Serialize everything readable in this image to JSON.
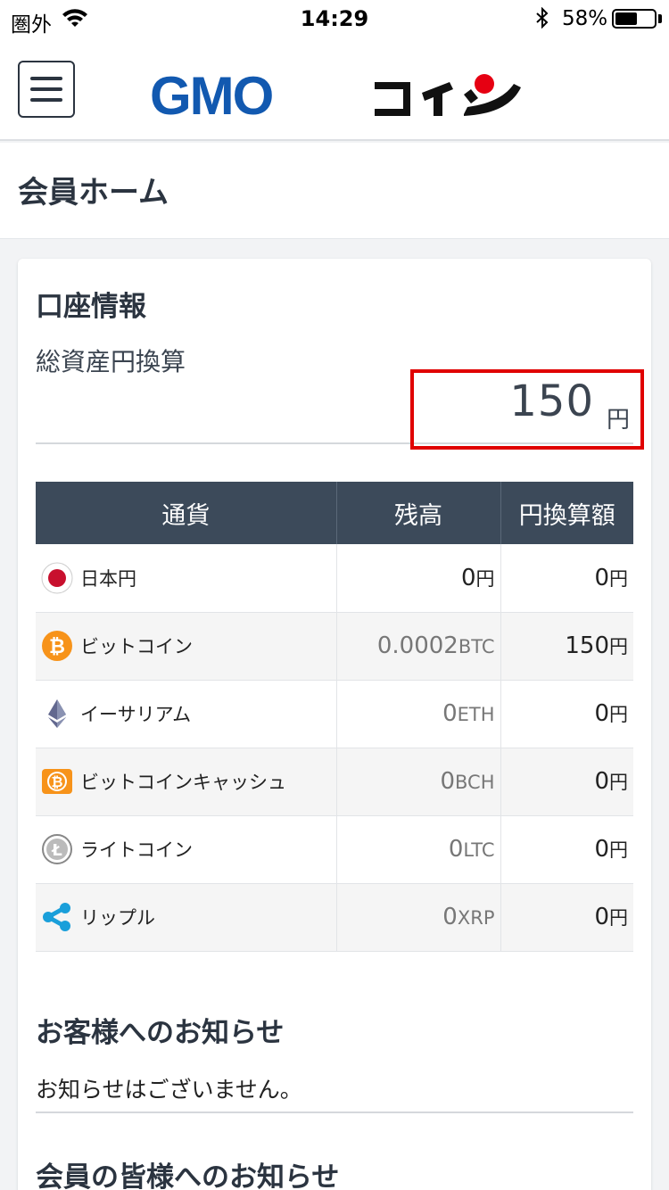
{
  "status_bar": {
    "carrier": "圏外",
    "time": "14:29",
    "battery_percent": "58%",
    "battery_level": 0.58
  },
  "header": {
    "logo_text": "GMOコイン",
    "menu_icon": "hamburger-icon"
  },
  "page": {
    "title": "会員ホーム"
  },
  "account": {
    "section_title": "口座情報",
    "total_label": "総資産円換算",
    "total_value": "150",
    "total_unit": "円",
    "highlight_color": "#e00000"
  },
  "table": {
    "headers": [
      "通貨",
      "残高",
      "円換算額"
    ],
    "rows": [
      {
        "icon": "jpy-flag-icon",
        "name": "日本円",
        "balance": "0",
        "balance_unit": "円",
        "jpy": "0",
        "jpy_unit": "円"
      },
      {
        "icon": "bitcoin-icon",
        "name": "ビットコイン",
        "balance": "0.0002",
        "balance_unit": "BTC",
        "jpy": "150",
        "jpy_unit": "円"
      },
      {
        "icon": "ethereum-icon",
        "name": "イーサリアム",
        "balance": "0",
        "balance_unit": "ETH",
        "jpy": "0",
        "jpy_unit": "円"
      },
      {
        "icon": "bitcoin-cash-icon",
        "name": "ビットコインキャッシュ",
        "balance": "0",
        "balance_unit": "BCH",
        "jpy": "0",
        "jpy_unit": "円"
      },
      {
        "icon": "litecoin-icon",
        "name": "ライトコイン",
        "balance": "0",
        "balance_unit": "LTC",
        "jpy": "0",
        "jpy_unit": "円"
      },
      {
        "icon": "ripple-icon",
        "name": "リップル",
        "balance": "0",
        "balance_unit": "XRP",
        "jpy": "0",
        "jpy_unit": "円"
      }
    ]
  },
  "notices": {
    "customer_title": "お客様へのお知らせ",
    "customer_text": "お知らせはございません。",
    "member_title": "会員の皆様へのお知らせ"
  },
  "colors": {
    "header_bg": "#3c4a5a",
    "brand_blue": "#1259b0",
    "brand_red": "#e60012"
  }
}
